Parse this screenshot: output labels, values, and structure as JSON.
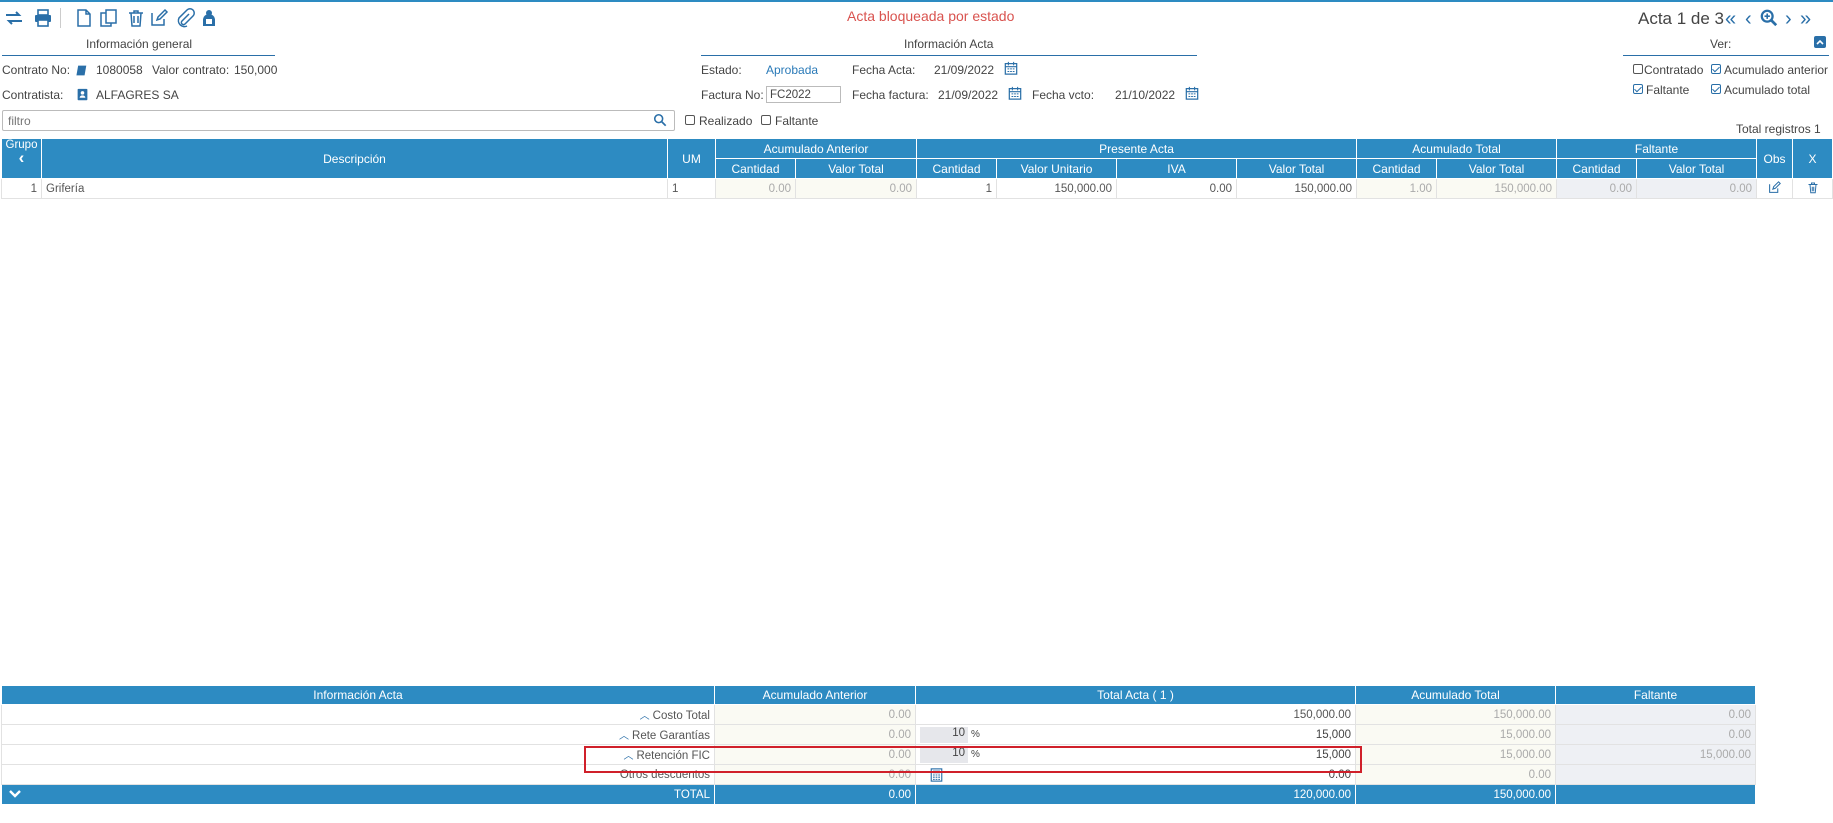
{
  "toolbar": {
    "status_text": "Acta bloqueada por estado",
    "pager_label": "Acta 1 de 3"
  },
  "general": {
    "section_title": "Información general",
    "contrato_label": "Contrato No:",
    "contrato_value": "1080058",
    "valor_label": "Valor contrato:",
    "valor_value": "150,000",
    "contratista_label": "Contratista:",
    "contratista_value": "ALFAGRES SA"
  },
  "acta_info": {
    "section_title": "Información Acta",
    "estado_label": "Estado:",
    "estado_value": "Aprobada",
    "fecha_acta_label": "Fecha Acta:",
    "fecha_acta_value": "21/09/2022",
    "factura_label": "Factura No:",
    "factura_value": "FC2022",
    "fecha_factura_label": "Fecha factura:",
    "fecha_factura_value": "21/09/2022",
    "fecha_vcto_label": "Fecha vcto:",
    "fecha_vcto_value": "21/10/2022"
  },
  "ver": {
    "title": "Ver:",
    "options": [
      {
        "label": "Contratado",
        "checked": false
      },
      {
        "label": "Acumulado anterior",
        "checked": true
      },
      {
        "label": "Faltante",
        "checked": true
      },
      {
        "label": "Acumulado total",
        "checked": true
      }
    ]
  },
  "filter": {
    "placeholder": "filtro",
    "realizado_label": "Realizado",
    "faltante_label": "Faltante",
    "total_registros": "Total registros 1"
  },
  "grid": {
    "headers": {
      "grupo": "Grupo",
      "descripcion": "Descripción",
      "um": "UM",
      "acum_anterior": "Acumulado Anterior",
      "presente": "Presente Acta",
      "acum_total": "Acumulado Total",
      "faltante": "Faltante",
      "obs": "Obs",
      "x": "X",
      "cantidad": "Cantidad",
      "valor_total": "Valor Total",
      "valor_unitario": "Valor Unitario",
      "iva": "IVA"
    },
    "rows": [
      {
        "grupo": "1",
        "descripcion": "Grifería",
        "um": "1",
        "aa_cant": "0.00",
        "aa_val": "0.00",
        "pa_cant": "1",
        "pa_vunit": "150,000.00",
        "pa_iva": "0.00",
        "pa_vtot": "150,000.00",
        "at_cant": "1.00",
        "at_val": "150,000.00",
        "f_cant": "0.00",
        "f_val": "0.00"
      }
    ]
  },
  "summary": {
    "headers": {
      "info": "Información Acta",
      "acum_anterior": "Acumulado Anterior",
      "total_acta": "Total Acta ( 1 )",
      "acum_total": "Acumulado Total",
      "faltante": "Faltante"
    },
    "rows": [
      {
        "label": "Costo Total",
        "aa": "0.00",
        "pct": "",
        "pct_sign": "",
        "ta": "150,000.00",
        "at": "150,000.00",
        "f": "0.00"
      },
      {
        "label": "Rete Garantías",
        "aa": "0.00",
        "pct": "10",
        "pct_sign": "%",
        "ta": "15,000",
        "at": "15,000.00",
        "f": "0.00"
      },
      {
        "label": "Retención FIC",
        "aa": "0.00",
        "pct": "10",
        "pct_sign": "%",
        "ta": "15,000",
        "at": "15,000.00",
        "f": "15,000.00"
      },
      {
        "label": "Otros descuentos",
        "aa": "0.00",
        "pct": "",
        "pct_sign": "",
        "ta": "0.00",
        "at": "0.00",
        "f": ""
      }
    ],
    "total": {
      "label": "TOTAL",
      "aa": "0.00",
      "ta": "120,000.00",
      "at": "150,000.00",
      "f": ""
    }
  },
  "colors": {
    "accent": "#2d8bc2",
    "status_red": "#d9534f",
    "highlight_box": "#d0202a"
  }
}
